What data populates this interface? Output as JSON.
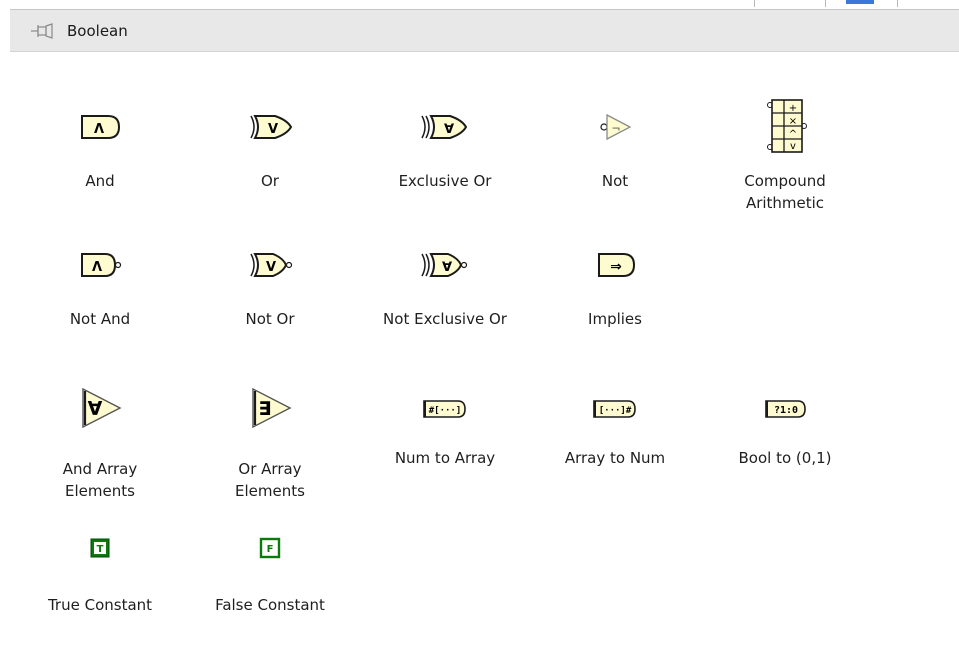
{
  "palette": {
    "title": "Boolean"
  },
  "items": [
    {
      "label": "And",
      "icon": "and-icon",
      "glyph": "Λ"
    },
    {
      "label": "Or",
      "icon": "or-icon",
      "glyph": "V"
    },
    {
      "label": "Exclusive Or",
      "icon": "exclusive-or-icon",
      "glyph": "∀"
    },
    {
      "label": "Not",
      "icon": "not-icon",
      "glyph": "¬"
    },
    {
      "label_line1": "Compound",
      "label_line2": "Arithmetic",
      "icon": "compound-arithmetic-icon",
      "glyphs": [
        "+",
        "×",
        "^",
        "v"
      ]
    },
    {
      "label": "Not And",
      "icon": "not-and-icon",
      "glyph": "Λ"
    },
    {
      "label": "Not Or",
      "icon": "not-or-icon",
      "glyph": "V"
    },
    {
      "label": "Not Exclusive Or",
      "icon": "not-exclusive-or-icon",
      "glyph": "∀"
    },
    {
      "label": "Implies",
      "icon": "implies-icon",
      "glyph": "⇒"
    },
    {
      "label_line1": "And Array",
      "label_line2": "Elements",
      "icon": "and-array-elements-icon",
      "glyph": "∀"
    },
    {
      "label_line1": "Or Array",
      "label_line2": "Elements",
      "icon": "or-array-elements-icon",
      "glyph": "∃"
    },
    {
      "label": "Num to Array",
      "icon": "num-to-array-icon",
      "glyph": "#[···]"
    },
    {
      "label": "Array to Num",
      "icon": "array-to-num-icon",
      "glyph": "[···]#"
    },
    {
      "label": "Bool to (0,1)",
      "icon": "bool-to-01-icon",
      "glyph": "?1:0"
    },
    {
      "label": "True Constant",
      "icon": "true-constant-icon",
      "glyph": "T"
    },
    {
      "label": "False Constant",
      "icon": "false-constant-icon",
      "glyph": "F"
    }
  ],
  "colors": {
    "gate_fill": "#fffbd0",
    "gate_stroke": "#1a1a1a",
    "constant_green": "#0b7a0b",
    "header_bg": "#e8e8e8"
  }
}
